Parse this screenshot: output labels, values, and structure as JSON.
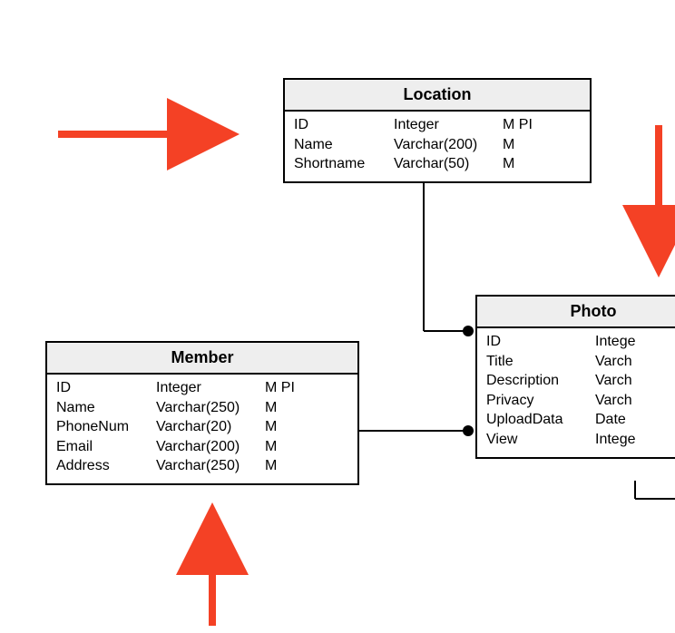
{
  "entities": {
    "location": {
      "title": "Location",
      "rows": [
        {
          "name": "ID",
          "type": "Integer",
          "flags": "M PI"
        },
        {
          "name": "Name",
          "type": "Varchar(200)",
          "flags": "M"
        },
        {
          "name": "Shortname",
          "type": "Varchar(50)",
          "flags": "M"
        }
      ]
    },
    "member": {
      "title": "Member",
      "rows": [
        {
          "name": "ID",
          "type": "Integer",
          "flags": "M PI"
        },
        {
          "name": "Name",
          "type": "Varchar(250)",
          "flags": "M"
        },
        {
          "name": "PhoneNum",
          "type": "Varchar(20)",
          "flags": "M"
        },
        {
          "name": "Email",
          "type": "Varchar(200)",
          "flags": "M"
        },
        {
          "name": "Address",
          "type": "Varchar(250)",
          "flags": "M"
        }
      ]
    },
    "photo": {
      "title": "Photo",
      "rows": [
        {
          "name": "ID",
          "type": "Intege",
          "flags": ""
        },
        {
          "name": "Title",
          "type": "Varch",
          "flags": ""
        },
        {
          "name": "Description",
          "type": "Varch",
          "flags": ""
        },
        {
          "name": "Privacy",
          "type": "Varch",
          "flags": ""
        },
        {
          "name": "UploadData",
          "type": "Date",
          "flags": ""
        },
        {
          "name": "View",
          "type": "Intege",
          "flags": ""
        }
      ]
    }
  },
  "arrows": {
    "color": "#f44125"
  }
}
